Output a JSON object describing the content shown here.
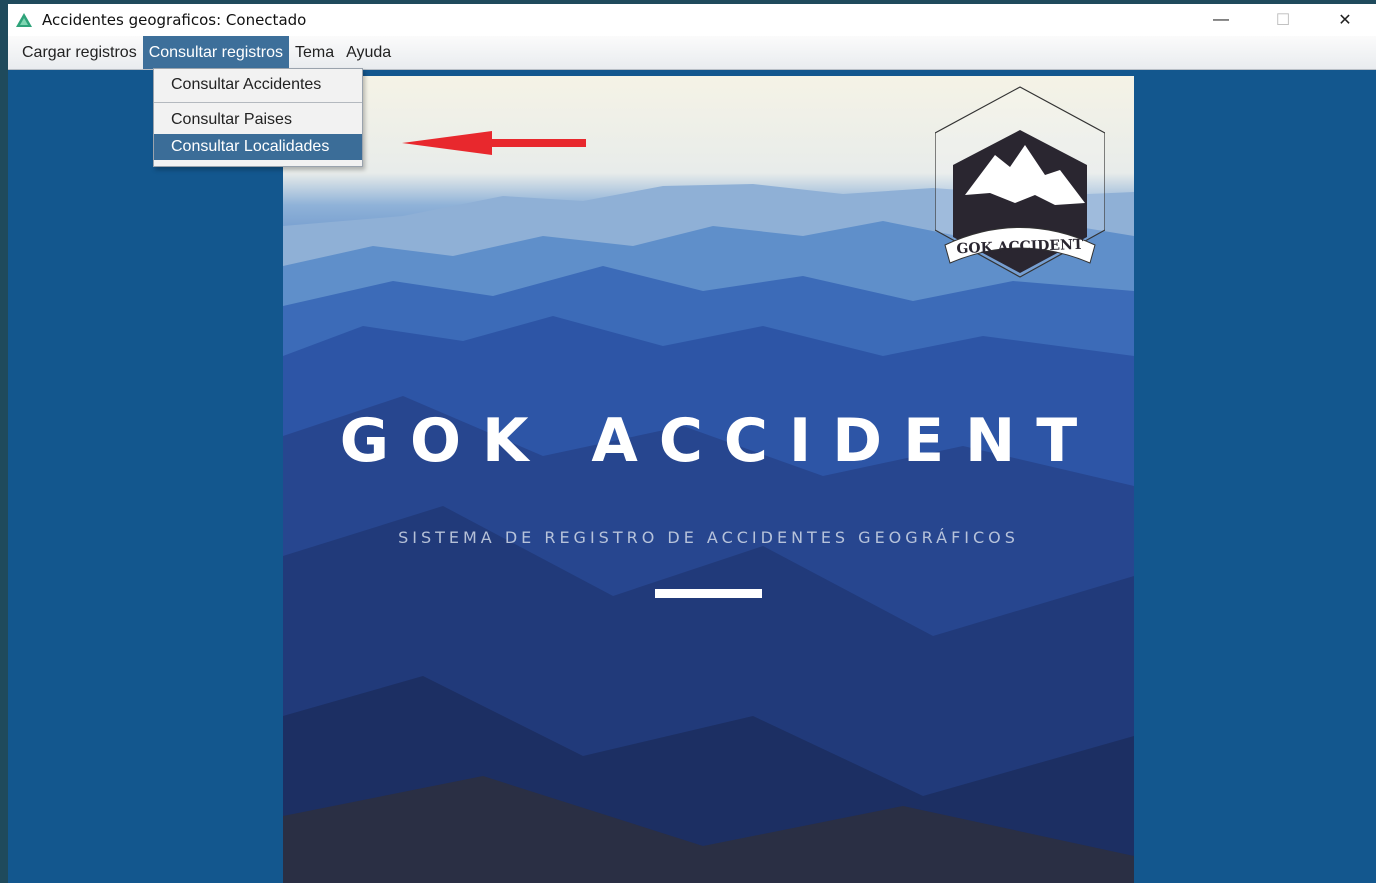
{
  "window": {
    "title": "Accidentes geograficos: Conectado",
    "controls": {
      "minimize": "—",
      "maximize": "☐",
      "close": "✕"
    }
  },
  "menubar": {
    "items": [
      {
        "label": "Cargar registros"
      },
      {
        "label": "Consultar registros",
        "active": true
      },
      {
        "label": "Tema"
      },
      {
        "label": "Ayuda"
      }
    ]
  },
  "dropdown": {
    "items": [
      {
        "label": "Consultar Accidentes"
      },
      {
        "label": "Consultar Paises"
      },
      {
        "label": "Consultar Localidades",
        "selected": true
      }
    ]
  },
  "poster": {
    "title": "GOK ACCIDENT",
    "subtitle": "SISTEMA DE REGISTRO DE ACCIDENTES GEOGRÁFICOS",
    "logo_text": "GOK ACCIDENT"
  },
  "colors": {
    "window_background": "#13578e",
    "menu_active": "#3d6f9a",
    "annotation_arrow": "#e8282d"
  },
  "icons": {
    "app": "mountain-icon",
    "annotation": "red-arrow-icon"
  }
}
